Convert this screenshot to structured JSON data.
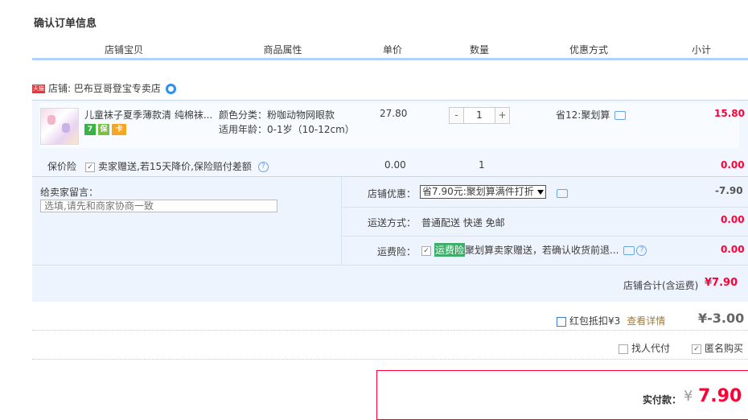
{
  "title": "确认订单信息",
  "columns": [
    "店铺宝贝",
    "商品属性",
    "单价",
    "数量",
    "优惠方式",
    "小计"
  ],
  "shop": {
    "tag": "天猫",
    "label": "店铺: 巴布豆哥登宝专卖店"
  },
  "item": {
    "name": "儿童袜子夏季薄款清 纯棉袜...",
    "badges": [
      "7",
      "保",
      "卡"
    ],
    "color": "颜色分类：粉咖动物网眼款",
    "age": "适用年龄：0-1岁（10-12cm）",
    "price": "27.80",
    "qty_minus": "-",
    "qty": "1",
    "qty_plus": "+",
    "discount": "省12:聚划算",
    "subtotal": "15.80"
  },
  "insurance": {
    "label": "保价险",
    "check": "卖家赠送,若15天降价,保险赔付差额",
    "help": "?",
    "price": "0.00",
    "qty": "1",
    "subtotal": "0.00"
  },
  "message": {
    "label": "给卖家留言：",
    "placeholder": "选填,请先和商家协商一致"
  },
  "shop_discount": {
    "label": "店铺优惠：",
    "selected": "省7.90元:聚划算满件打折",
    "amount": "-7.90"
  },
  "shipping": {
    "label": "运送方式：",
    "value": "普通配送 快递 免邮",
    "amount": "0.00"
  },
  "freight_insurance": {
    "label": "运费险：",
    "tag": "运费险",
    "value": "聚划算卖家赠送，若确认收货前退...",
    "help": "?",
    "amount": "0.00"
  },
  "shop_total": {
    "label": "店铺合计(含运费)",
    "amount": "¥7.90"
  },
  "hongbao": {
    "label": "红包抵扣¥3",
    "link": "查看详情",
    "amount": "¥-3.00"
  },
  "options": {
    "proxy": "找人代付",
    "anonymous": "匿名购买"
  },
  "pay": {
    "label": "实付款：",
    "currency": "¥",
    "amount": "7.90"
  },
  "colors": {
    "accent": "#ff0036",
    "header_line": "#b2d1ff",
    "panel": "#eef4fd"
  }
}
